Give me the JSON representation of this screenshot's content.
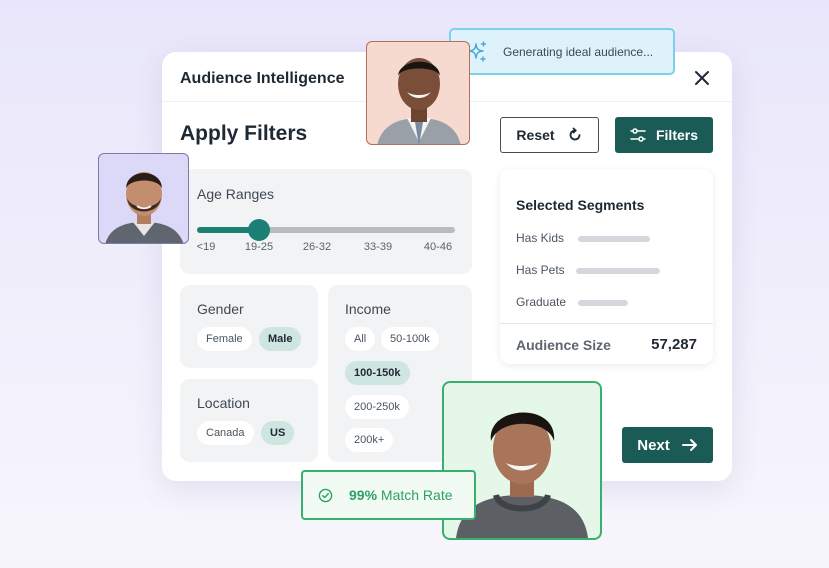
{
  "card": {
    "title": "Audience Intelligence",
    "heading": "Apply Filters"
  },
  "toolbar": {
    "reset_label": "Reset",
    "filters_label": "Filters"
  },
  "toast": {
    "text": "Generating ideal audience..."
  },
  "age": {
    "label": "Age Ranges",
    "ticks": [
      "<19",
      "19-25",
      "26-32",
      "33-39",
      "40-46"
    ],
    "selected": "19-25"
  },
  "gender": {
    "label": "Gender",
    "options": [
      "Female",
      "Male"
    ],
    "selected": "Male"
  },
  "location": {
    "label": "Location",
    "options": [
      "Canada",
      "US"
    ],
    "selected": "US"
  },
  "income": {
    "label": "Income",
    "options": [
      "All",
      "50-100k",
      "100-150k",
      "200-250k",
      "200k+"
    ],
    "selected": "100-150k"
  },
  "segments": {
    "title": "Selected Segments",
    "items": [
      "Has Kids",
      "Has Pets",
      "Graduate"
    ],
    "audience_label": "Audience Size",
    "audience_value": "57,287"
  },
  "next_label": "Next",
  "match": {
    "value": "99%",
    "label": "Match Rate"
  },
  "colors": {
    "accent": "#1b5b56",
    "slider": "#1b7f74",
    "match": "#36b06e",
    "toast_border": "#7cd0ec"
  },
  "icons": [
    "close-icon",
    "refresh-icon",
    "sliders-icon",
    "sparkle-icon",
    "arrow-right-icon",
    "check-circle-icon"
  ]
}
